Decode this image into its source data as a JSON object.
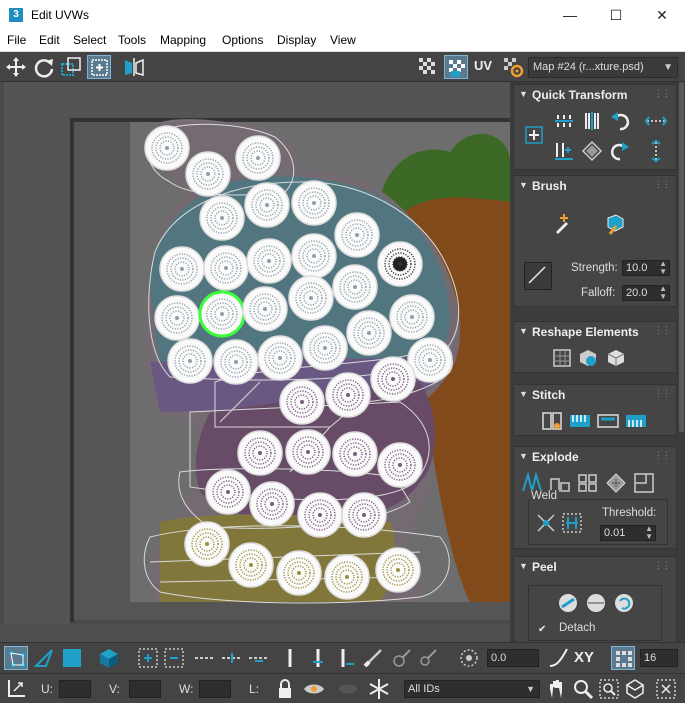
{
  "window": {
    "title": "Edit UVWs",
    "app_icon": "3"
  },
  "menu": [
    "File",
    "Edit",
    "Select",
    "Tools",
    "Mapping",
    "Options",
    "Display",
    "View"
  ],
  "toolbar": {
    "uv_label": "UV",
    "map_select": "Map #24 (r...xture.psd)"
  },
  "panel": {
    "quick_transform": {
      "title": "Quick Transform"
    },
    "brush": {
      "title": "Brush",
      "strength_label": "Strength:",
      "strength_value": "10.0",
      "falloff_label": "Falloff:",
      "falloff_value": "20.0"
    },
    "reshape": {
      "title": "Reshape Elements"
    },
    "stitch": {
      "title": "Stitch"
    },
    "explode": {
      "title": "Explode",
      "weld_label": "Weld",
      "threshold_label": "Threshold:",
      "threshold_value": "0.01"
    },
    "peel": {
      "title": "Peel",
      "detach_label": "Detach",
      "detach_checked": true
    }
  },
  "bottom": {
    "angle_value": "0.0",
    "xy_label": "XY",
    "grid_value": "16",
    "u_label": "U:",
    "v_label": "V:",
    "w_label": "W:",
    "l_label": "L:",
    "ids_select": "All IDs"
  },
  "colors": {
    "accent": "#1ea0c8",
    "uv_highlight": "#3cff3c"
  }
}
